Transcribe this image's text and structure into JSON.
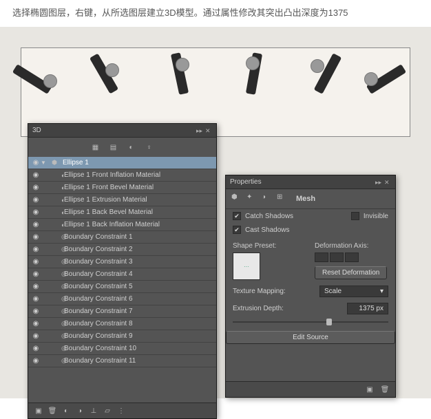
{
  "instruction": "选择椭圆图层，右键，从所选图层建立3D模型。通过属性修改其突出凸出深度为1375",
  "panels": {
    "threed": {
      "title": "3D"
    },
    "properties": {
      "title": "Properties",
      "tab": "Mesh"
    }
  },
  "layers": {
    "root": "Ellipse 1",
    "items": [
      "Ellipse 1 Front Inflation Material",
      "Ellipse 1 Front Bevel Material",
      "Ellipse 1 Extrusion Material",
      "Ellipse 1 Back Bevel Material",
      "Ellipse 1 Back Inflation Material",
      "Boundary Constraint 1",
      "Boundary Constraint 2",
      "Boundary Constraint 3",
      "Boundary Constraint 4",
      "Boundary Constraint 5",
      "Boundary Constraint 6",
      "Boundary Constraint 7",
      "Boundary Constraint 8",
      "Boundary Constraint 9",
      "Boundary Constraint 10",
      "Boundary Constraint 11"
    ]
  },
  "props": {
    "catch_shadows": "Catch Shadows",
    "cast_shadows": "Cast Shadows",
    "invisible": "Invisible",
    "shape_preset_label": "Shape Preset:",
    "deformation_axis_label": "Deformation Axis:",
    "reset_deformation": "Reset Deformation",
    "texture_mapping_label": "Texture Mapping:",
    "texture_mapping_value": "Scale",
    "extrusion_depth_label": "Extrusion Depth:",
    "extrusion_depth_value": "1375 px",
    "edit_source": "Edit Source"
  }
}
